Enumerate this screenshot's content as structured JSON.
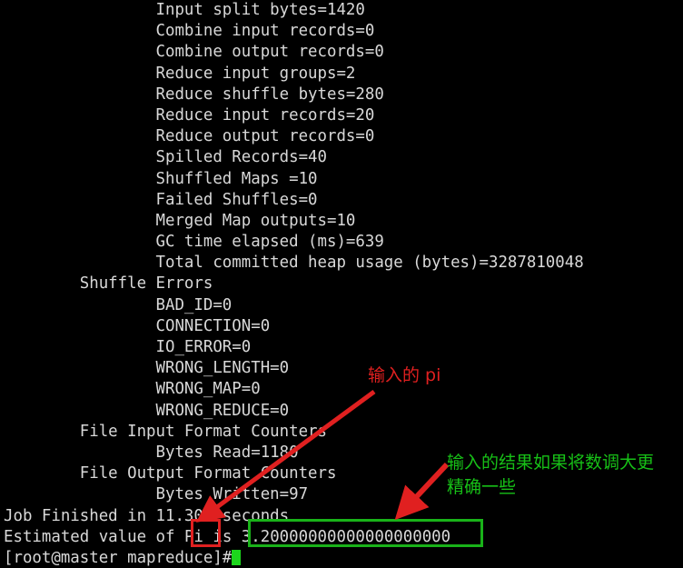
{
  "terminal": {
    "lines": [
      "                Input split bytes=1420",
      "                Combine input records=0",
      "                Combine output records=0",
      "                Reduce input groups=2",
      "                Reduce shuffle bytes=280",
      "                Reduce input records=20",
      "                Reduce output records=0",
      "                Spilled Records=40",
      "                Shuffled Maps =10",
      "                Failed Shuffles=0",
      "                Merged Map outputs=10",
      "                GC time elapsed (ms)=639",
      "                Total committed heap usage (bytes)=3287810048",
      "        Shuffle Errors",
      "                BAD_ID=0",
      "                CONNECTION=0",
      "                IO_ERROR=0",
      "                WRONG_LENGTH=0",
      "                WRONG_MAP=0",
      "                WRONG_REDUCE=0",
      "        File Input Format Counters",
      "                Bytes Read=1180",
      "        File Output Format Counters",
      "                Bytes Written=97",
      "Job Finished in 11.301 seconds"
    ],
    "result_line": {
      "prefix": "Estimated value of ",
      "highlight_label": "Pi",
      "middle": " is ",
      "highlight_value": "3.20000000000000000000"
    },
    "prompt": "[root@master mapreduce]#",
    "cursor_glyph": "block-cursor"
  },
  "annotations": {
    "pi_label_note": "输入的 pi",
    "precision_note_line1": "输入的结果如果将数调大更",
    "precision_note_line2": "精确一些",
    "arrow_to_pi": "arrow-icon",
    "arrow_to_value": "arrow-icon"
  },
  "colors": {
    "background": "#000000",
    "text": "#d8d8d8",
    "annotation_red": "#e02020",
    "annotation_green": "#17c017",
    "box_red": "#e02020",
    "box_green": "#19b219",
    "cursor_green": "#1cd51c"
  }
}
